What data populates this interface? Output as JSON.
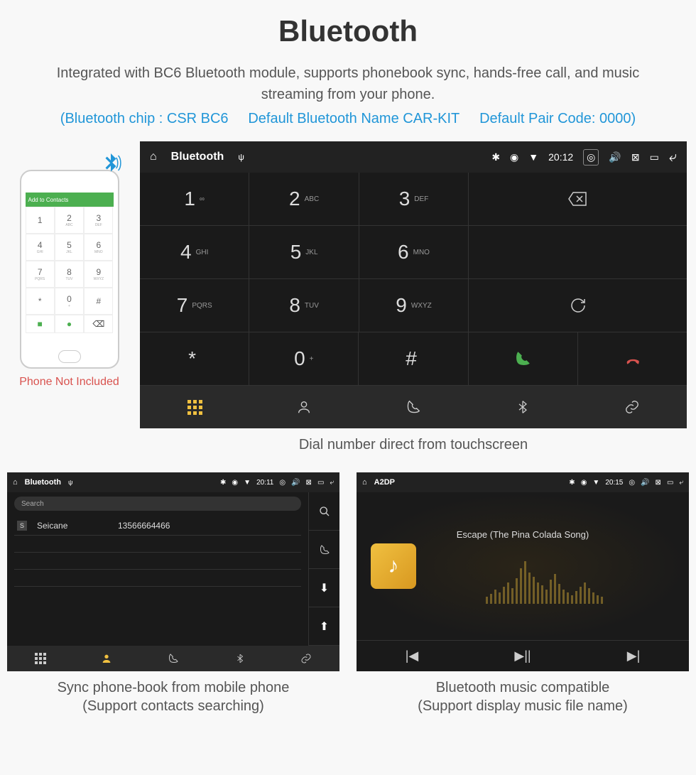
{
  "header": {
    "title": "Bluetooth",
    "subtitle": "Integrated with BC6 Bluetooth module, supports phonebook sync, hands-free call, and music streaming from your phone.",
    "blue_chip": "(Bluetooth chip : CSR BC6",
    "blue_name": "Default Bluetooth Name CAR-KIT",
    "blue_code": "Default Pair Code: 0000)"
  },
  "phone": {
    "header": "Add to Contacts",
    "note": "Phone Not Included"
  },
  "dialer": {
    "bar_title": "Bluetooth",
    "time": "20:12",
    "keys": [
      {
        "num": "1",
        "sub": "∞"
      },
      {
        "num": "2",
        "sub": "ABC"
      },
      {
        "num": "3",
        "sub": "DEF"
      },
      {
        "num": "4",
        "sub": "GHI"
      },
      {
        "num": "5",
        "sub": "JKL"
      },
      {
        "num": "6",
        "sub": "MNO"
      },
      {
        "num": "7",
        "sub": "PQRS"
      },
      {
        "num": "8",
        "sub": "TUV"
      },
      {
        "num": "9",
        "sub": "WXYZ"
      },
      {
        "num": "*",
        "sub": ""
      },
      {
        "num": "0",
        "sub": "+"
      },
      {
        "num": "#",
        "sub": ""
      }
    ],
    "caption": "Dial number direct from touchscreen"
  },
  "contacts": {
    "bar_title": "Bluetooth",
    "time": "20:11",
    "search": "Search",
    "list": [
      {
        "letter": "S",
        "name": "Seicane",
        "number": "13566664466"
      }
    ],
    "caption1": "Sync phone-book from mobile phone",
    "caption2": "(Support contacts searching)"
  },
  "music": {
    "bar_title": "A2DP",
    "time": "20:15",
    "track": "Escape (The Pina Colada Song)",
    "caption1": "Bluetooth music compatible",
    "caption2": "(Support display music file name)"
  }
}
